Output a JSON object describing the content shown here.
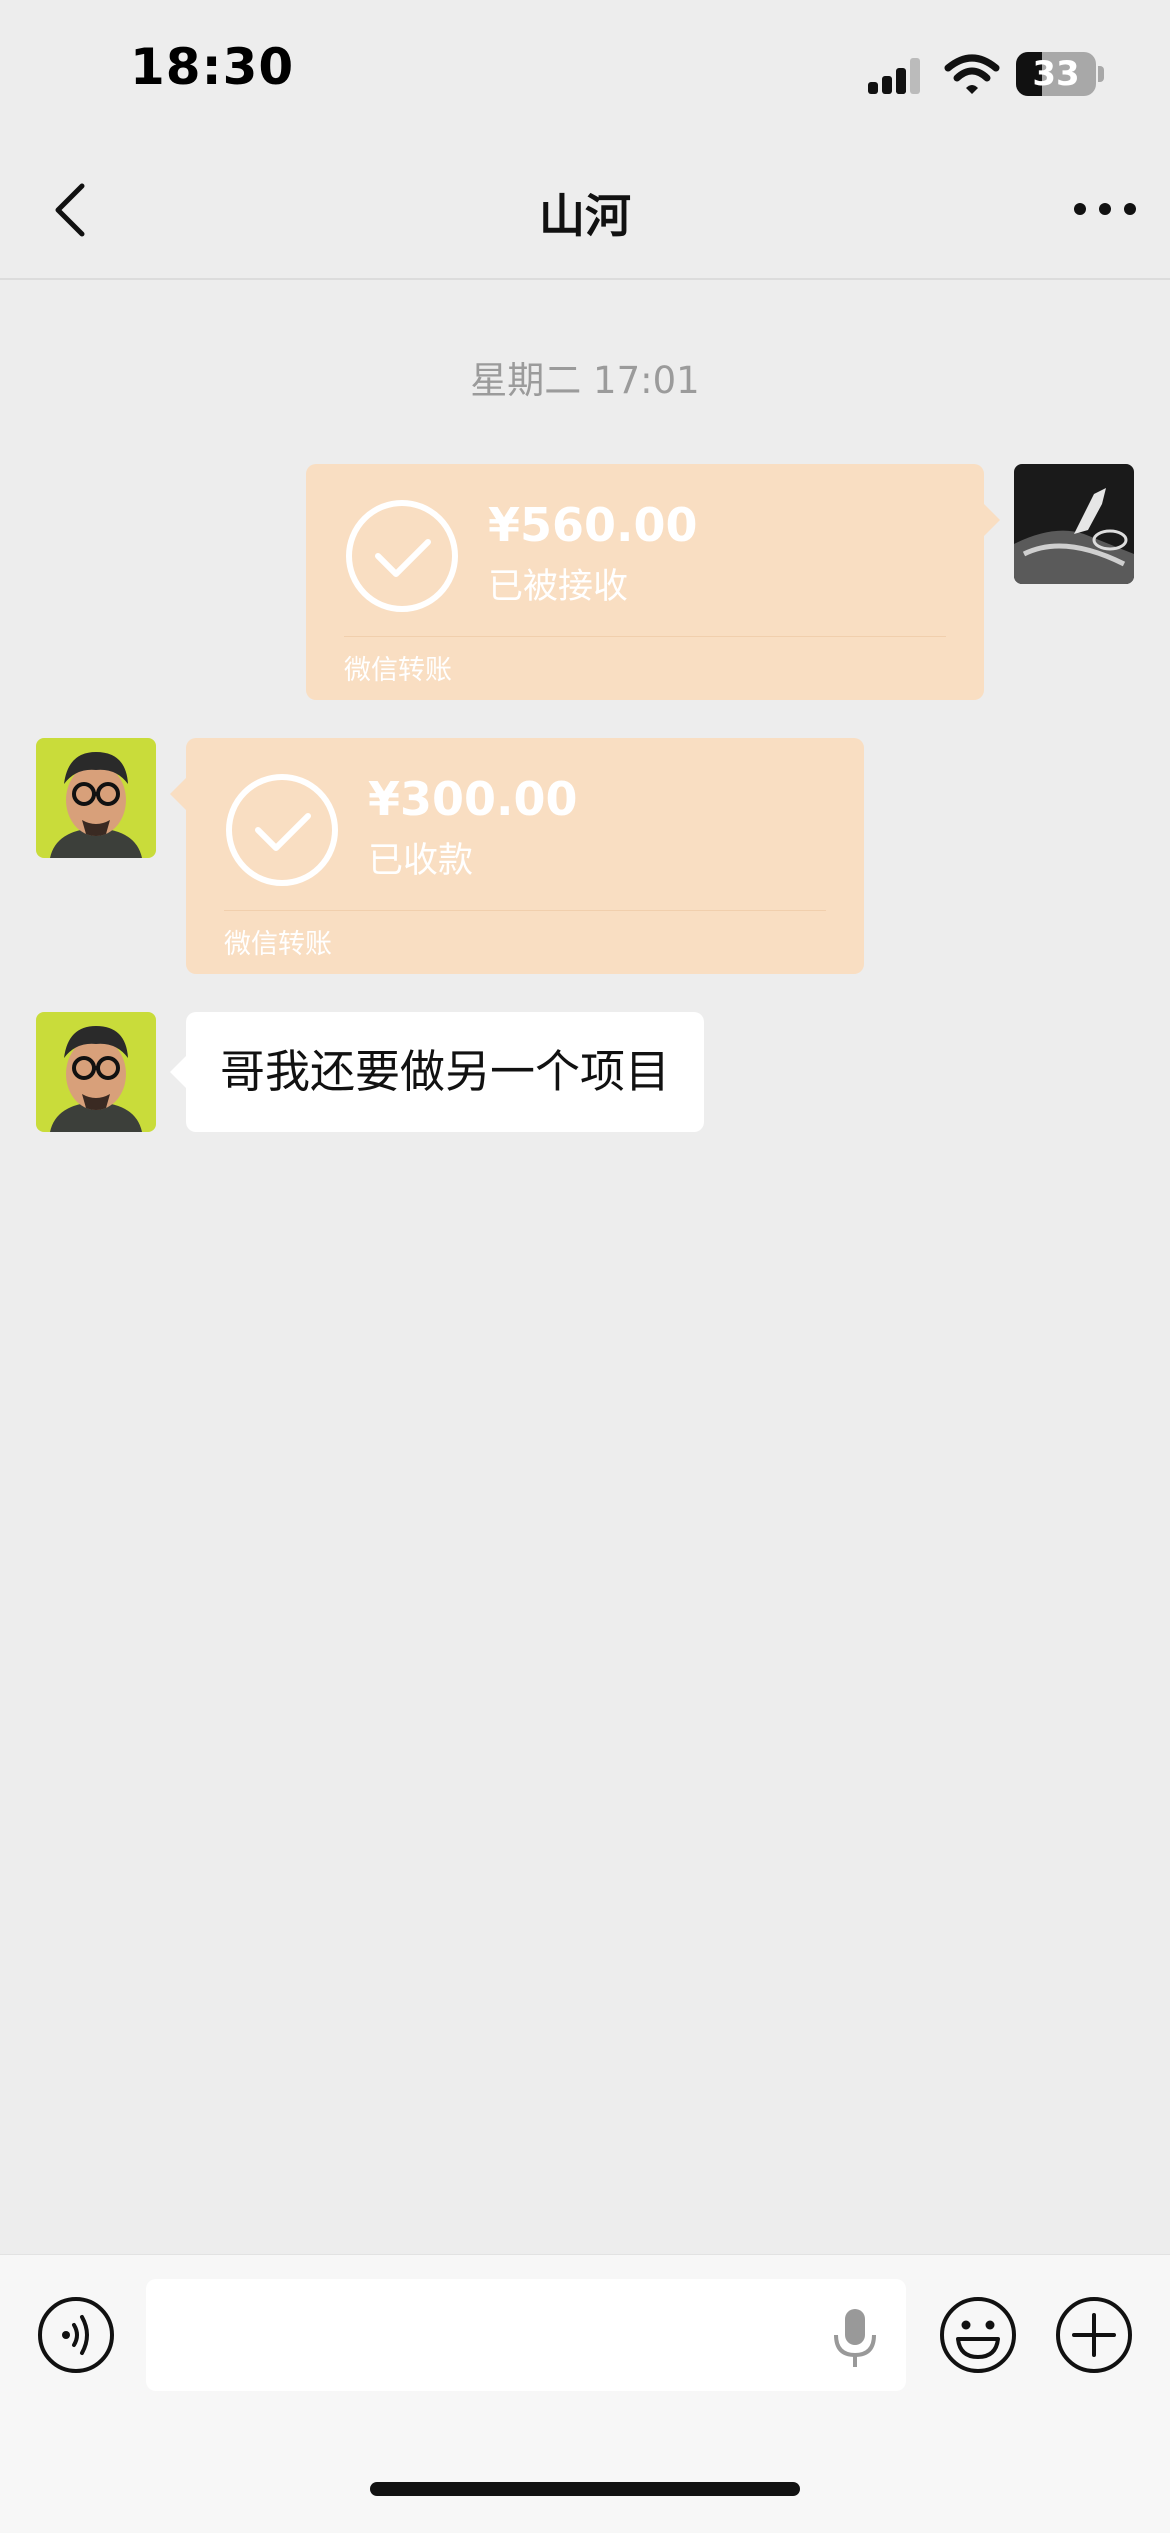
{
  "status_bar": {
    "time": "18:30",
    "battery_level": "33"
  },
  "header": {
    "title": "山河"
  },
  "chat": {
    "timestamp": "星期二 17:01",
    "messages": [
      {
        "type": "transfer",
        "direction": "outgoing",
        "amount": "¥560.00",
        "status": "已被接收",
        "footer": "微信转账"
      },
      {
        "type": "transfer",
        "direction": "incoming",
        "amount": "¥300.00",
        "status": "已收款",
        "footer": "微信转账"
      },
      {
        "type": "text",
        "direction": "incoming",
        "text": "哥我还要做另一个项目"
      }
    ]
  },
  "input_bar": {
    "value": "",
    "placeholder": ""
  },
  "colors": {
    "background": "#ededed",
    "transfer_bubble": "#f9dec2",
    "text_bubble": "#ffffff",
    "input_bar": "#f7f7f7"
  },
  "icons": [
    "back-icon",
    "more-icon",
    "check-circle-icon",
    "voice-icon",
    "mic-icon",
    "emoji-icon",
    "plus-icon"
  ]
}
